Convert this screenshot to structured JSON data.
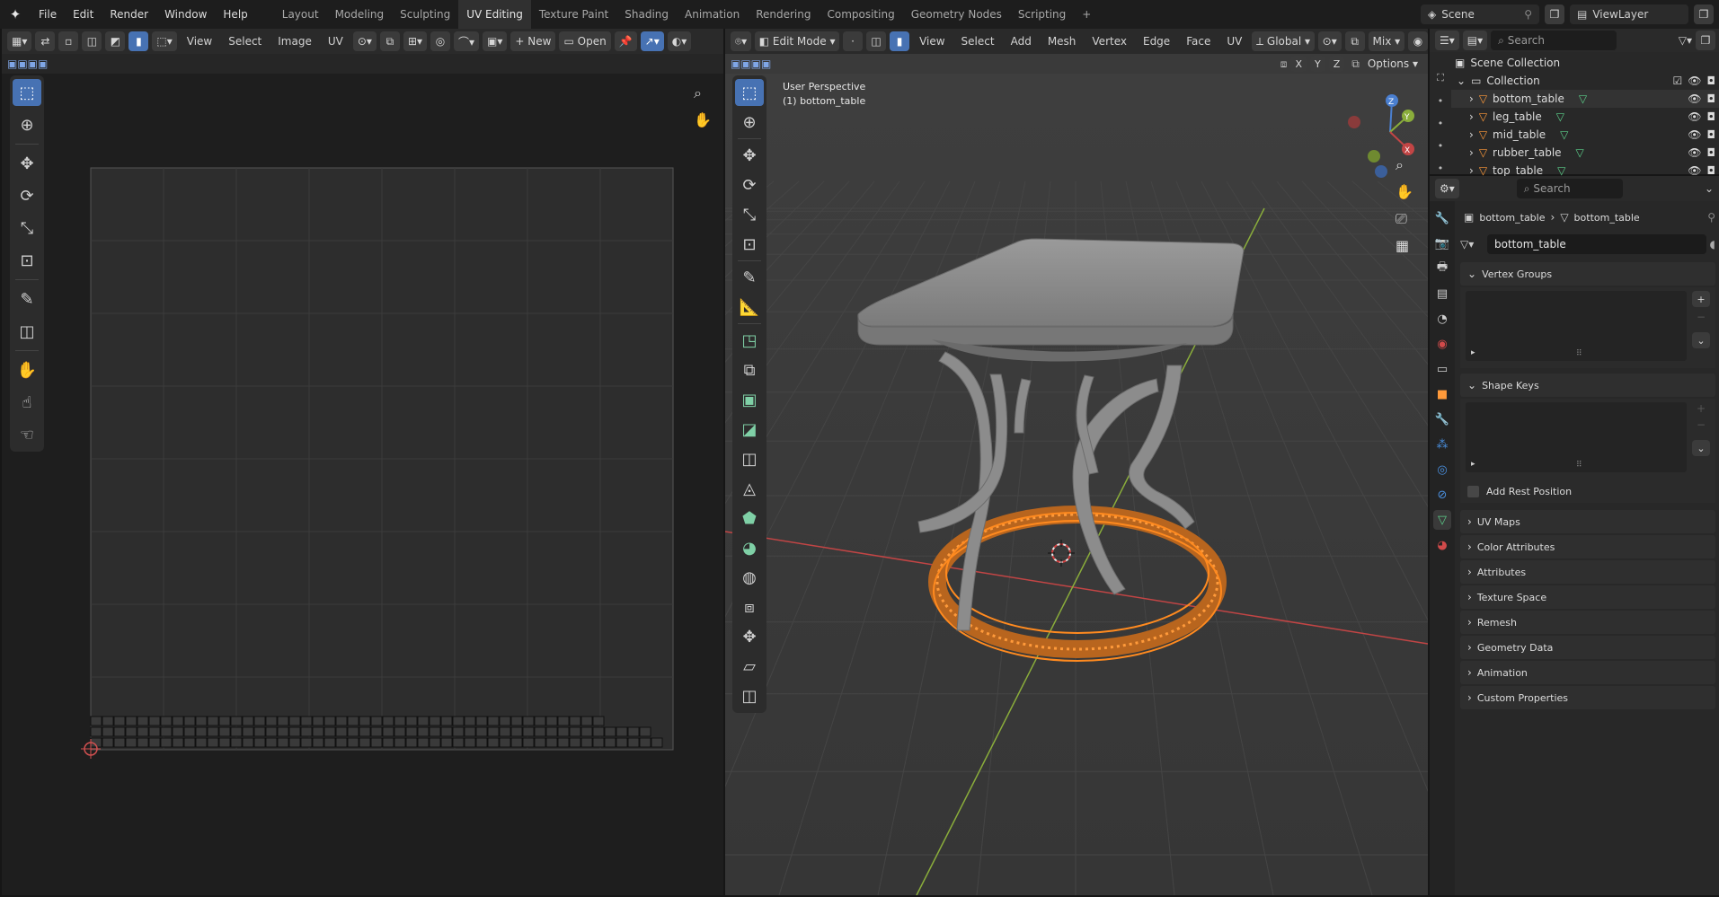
{
  "topbar": {
    "menus": [
      "File",
      "Edit",
      "Render",
      "Window",
      "Help"
    ],
    "workspaces": [
      "Layout",
      "Modeling",
      "Sculpting",
      "UV Editing",
      "Texture Paint",
      "Shading",
      "Animation",
      "Rendering",
      "Compositing",
      "Geometry Nodes",
      "Scripting"
    ],
    "active_workspace": "UV Editing",
    "scene": "Scene",
    "view_layer": "ViewLayer"
  },
  "uv_editor": {
    "menus": [
      "View",
      "Select",
      "Image",
      "UV"
    ],
    "new_label": "New",
    "open_label": "Open"
  },
  "viewport": {
    "mode": "Edit Mode",
    "menus": [
      "View",
      "Select",
      "Add",
      "Mesh",
      "Vertex",
      "Edge",
      "Face",
      "UV"
    ],
    "orientation": "Global",
    "pivot": "Mix",
    "overlay_title": "User Perspective",
    "overlay_object": "(1) bottom_table",
    "options_label": "Options",
    "axes": [
      "X",
      "Y",
      "Z"
    ],
    "colors": {
      "x_axis": "#c24545",
      "y_axis": "#8aad3b",
      "selection": "#ff8a1f",
      "mesh": "#8d8d8d"
    }
  },
  "outliner": {
    "search_placeholder": "Search",
    "scene_collection": "Scene Collection",
    "collection": "Collection",
    "objects": [
      "bottom_table",
      "leg_table",
      "mid_table",
      "rubber_table",
      "top_table"
    ]
  },
  "properties": {
    "search_placeholder": "Search",
    "breadcrumb_object": "bottom_table",
    "breadcrumb_data": "bottom_table",
    "mesh_name": "bottom_table",
    "panels": {
      "vertex_groups": "Vertex Groups",
      "shape_keys": "Shape Keys",
      "add_rest_position": "Add Rest Position",
      "uv_maps": "UV Maps",
      "color_attributes": "Color Attributes",
      "attributes": "Attributes",
      "texture_space": "Texture Space",
      "remesh": "Remesh",
      "geometry_data": "Geometry Data",
      "animation": "Animation",
      "custom_properties": "Custom Properties"
    }
  }
}
